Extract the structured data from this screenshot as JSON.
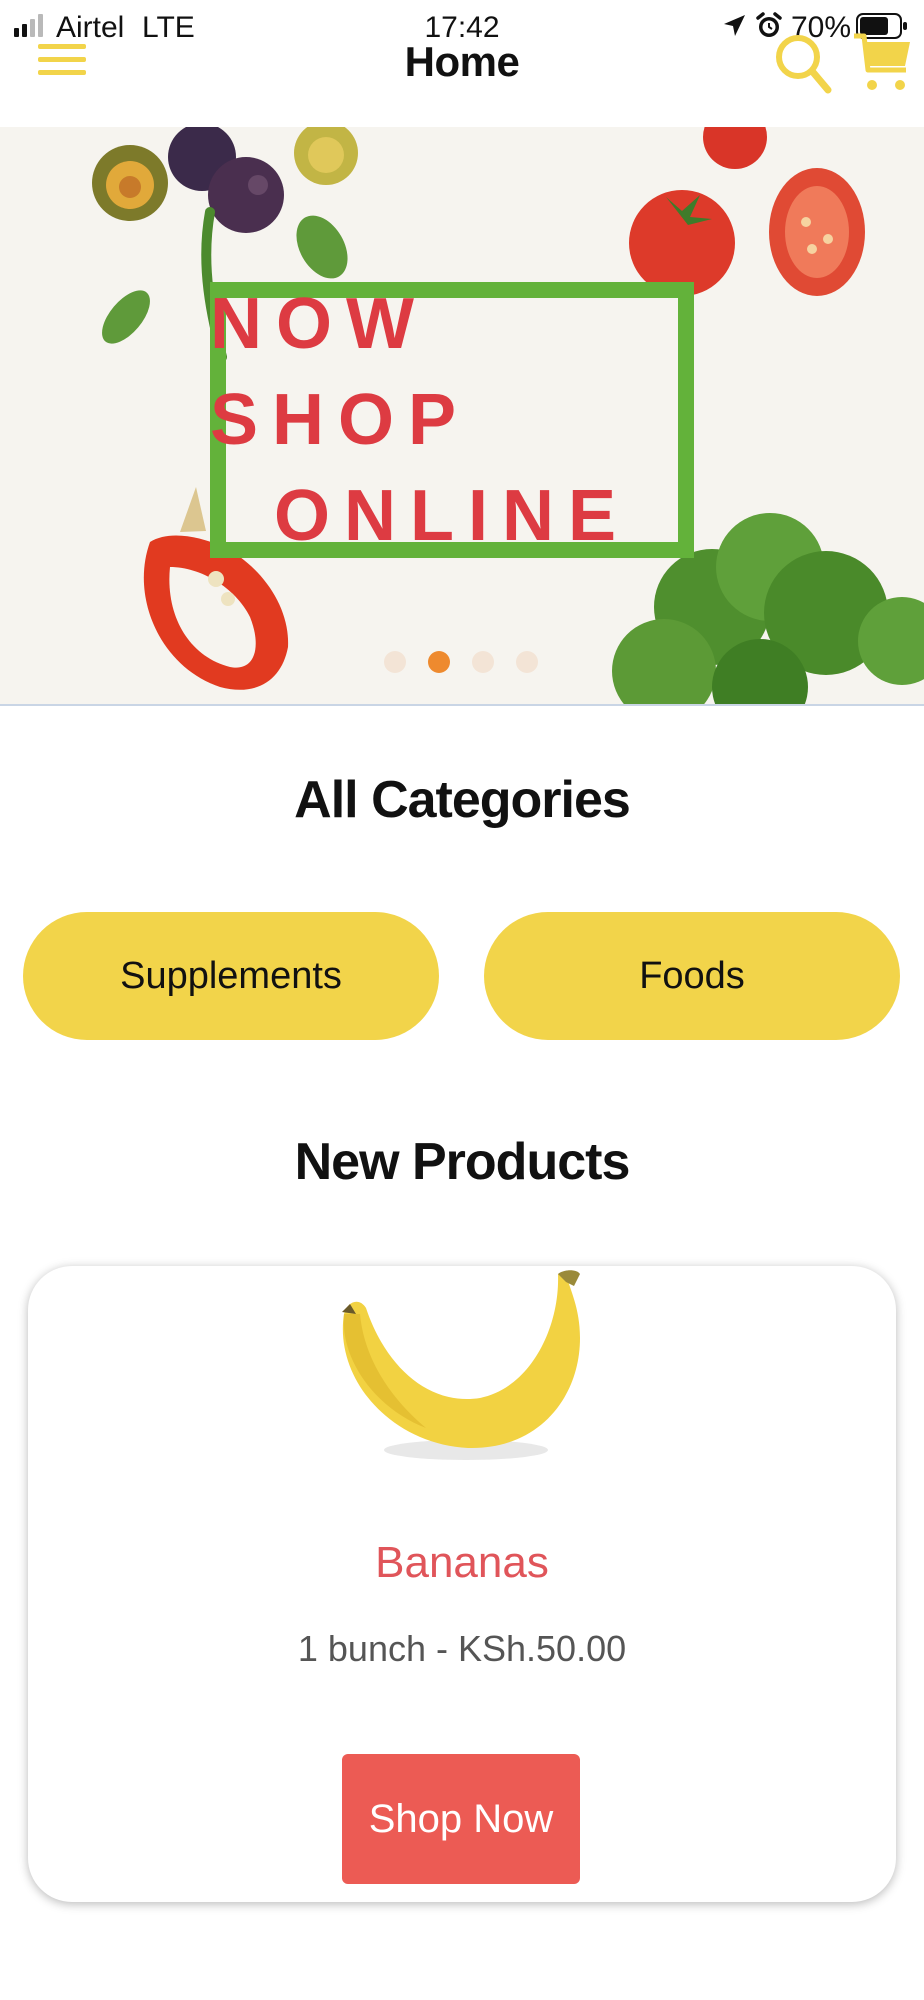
{
  "status_bar": {
    "carrier": "Airtel",
    "network": "LTE",
    "time": "17:42",
    "battery": "70%",
    "icons": [
      "signal-icon",
      "location-arrow-icon",
      "alarm-icon",
      "battery-icon"
    ]
  },
  "nav": {
    "title": "Home",
    "icons": [
      "menu-icon",
      "search-icon",
      "cart-icon"
    ],
    "accent": "#f2d44a"
  },
  "banner": {
    "line1": "NOW SHOP",
    "line2": "ONLINE",
    "slide_count": 4,
    "active_slide": 2,
    "text_color": "#dd3b42",
    "frame_color": "#63b23a"
  },
  "categories": {
    "title": "All Categories",
    "items": [
      "Supplements",
      "Foods"
    ],
    "button_color": "#f2d44a"
  },
  "new_products": {
    "title": "New Products",
    "items": [
      {
        "name": "Bananas",
        "price": "1 bunch - KSh.50.00",
        "button_label": "Shop Now",
        "image": "banana-image"
      }
    ],
    "button_color": "#ec5b54",
    "name_color": "#e0555a"
  }
}
